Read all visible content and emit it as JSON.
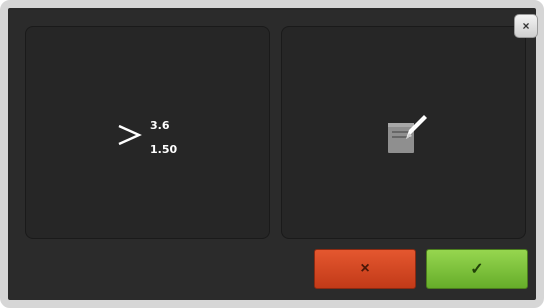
{
  "dialog": {
    "close_label": "×",
    "threshold": {
      "icon": "greater-than-icon",
      "upper": "3.6",
      "lower": "1.50"
    },
    "edit": {
      "icon": "edit-note-icon"
    },
    "actions": {
      "cancel_icon": "×",
      "confirm_icon": "✓"
    }
  },
  "colors": {
    "background": "#2b2b2b",
    "cancel": "#d4471f",
    "confirm": "#7cc13b"
  }
}
